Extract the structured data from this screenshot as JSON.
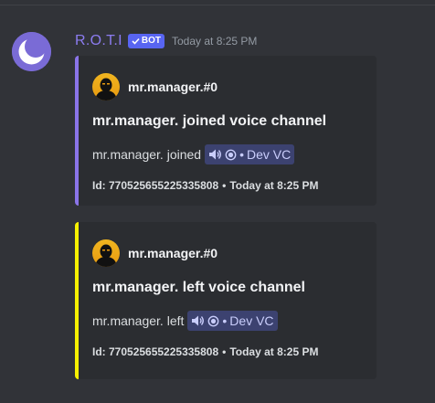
{
  "message": {
    "username": "R.O.T.I",
    "bot_badge": "BOT",
    "timestamp": "Today at 8:25 PM",
    "accent_color": "#8c7cf0"
  },
  "embeds": [
    {
      "accent": "#8a74e8",
      "author": "mr.manager.#0",
      "title": "mr.manager. joined voice channel",
      "description_prefix": "mr.manager. joined",
      "channel_name": "Dev VC",
      "channel_icons": [
        "speaker-icon",
        "live-dot-icon"
      ],
      "footer_id": "Id: 770525655225335808",
      "footer_time": "Today at 8:25 PM"
    },
    {
      "accent": "#f6f000",
      "author": "mr.manager.#0",
      "title": "mr.manager. left voice channel",
      "description_prefix": "mr.manager. left",
      "channel_name": "Dev VC",
      "channel_icons": [
        "speaker-icon",
        "live-dot-icon"
      ],
      "footer_id": "Id: 770525655225335808",
      "footer_time": "Today at 8:25 PM"
    }
  ]
}
